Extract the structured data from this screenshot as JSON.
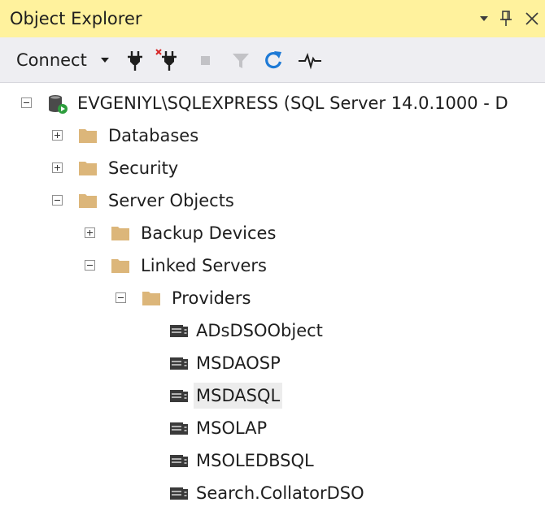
{
  "titlebar": {
    "title": "Object Explorer",
    "dropdown_glyph": "▾",
    "pin_glyph": "ᵖ",
    "close_glyph": "×"
  },
  "toolbar": {
    "connect_label": "Connect",
    "connect_caret": "▾",
    "icons": [
      "connect-icon",
      "disconnect-icon",
      "stop-icon",
      "filter-icon",
      "refresh-icon",
      "activity-monitor-icon"
    ]
  },
  "tree": {
    "server": "EVGENIYL\\SQLEXPRESS (SQL Server 14.0.1000 - D",
    "databases": "Databases",
    "security": "Security",
    "server_objects": "Server Objects",
    "backup_devices": "Backup Devices",
    "linked_servers": "Linked Servers",
    "providers": "Providers",
    "provider_items": [
      "ADsDSOObject",
      "MSDAOSP",
      "MSDASQL",
      "MSOLAP",
      "MSOLEDBSQL",
      "Search.CollatorDSO"
    ],
    "selected_item": "MSDASQL"
  },
  "colors": {
    "titlebar_bg": "#fff29d",
    "toolbar_bg": "#eeeef2",
    "folder": "#dcb67a",
    "refresh": "#1e7ad6",
    "server_green": "#2e9e3e",
    "selected_bg": "#ececec"
  }
}
